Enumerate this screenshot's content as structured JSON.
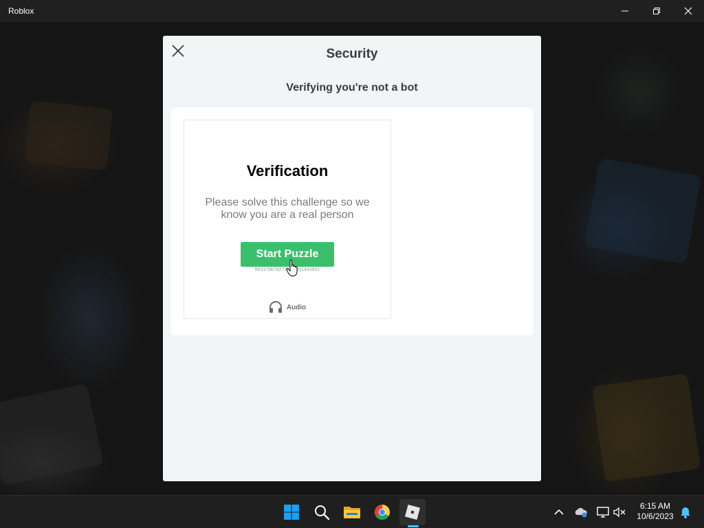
{
  "window": {
    "title": "Roblox"
  },
  "dialog": {
    "title": "Security",
    "subtitle": "Verifying you're not a bot",
    "challenge": {
      "heading": "Verification",
      "description": "Please solve this challenge so we know you are a real person",
      "start_button": "Start Puzzle",
      "session_id": "863178b7d2736...0811442601",
      "audio_label": "Audio"
    }
  },
  "taskbar": {
    "pinned": [
      "windows-start-icon",
      "search-icon",
      "file-explorer-icon",
      "chrome-icon",
      "roblox-icon"
    ],
    "active": "roblox-icon"
  },
  "tray": {
    "time": "6:15 AM",
    "date": "10/6/2023",
    "icons": [
      "chevron-up-icon",
      "onedrive-icon",
      "network-icon",
      "volume-muted-icon",
      "notification-bell-icon"
    ]
  },
  "colors": {
    "accent_green": "#3bbf6d",
    "modal_bg": "#f2f4f5",
    "taskbar_bg": "#1f1f1f",
    "active_indicator": "#4cc2ff"
  }
}
